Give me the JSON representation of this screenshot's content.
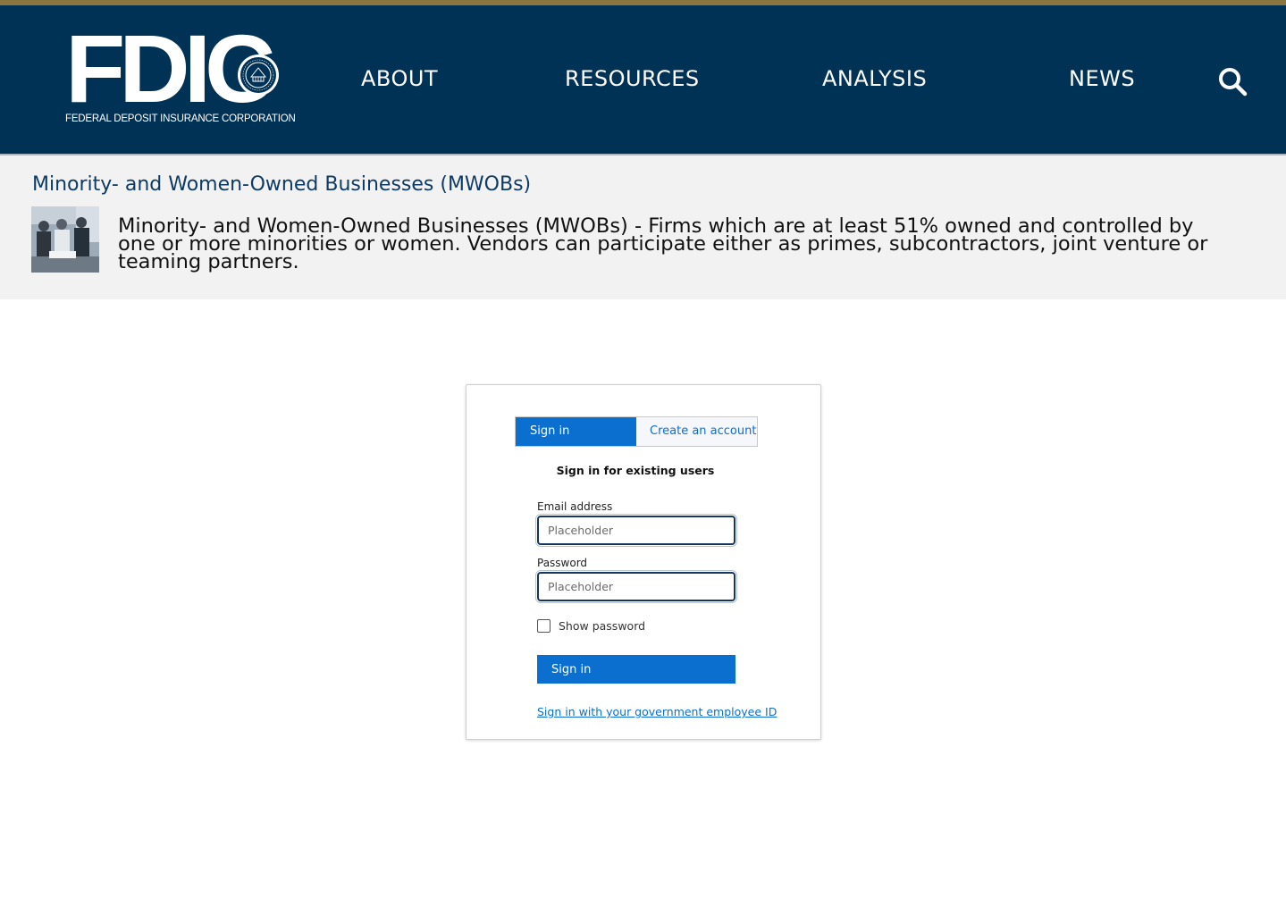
{
  "header": {
    "logo_text": "FDIC",
    "logo_subtitle": "FEDERAL DEPOSIT INSURANCE CORPORATION",
    "seal_icon": "fdic-seal-icon",
    "nav": [
      {
        "label": "ABOUT"
      },
      {
        "label": "RESOURCES"
      },
      {
        "label": "ANALYSIS"
      },
      {
        "label": "NEWS"
      }
    ],
    "search_icon": "search-icon"
  },
  "banner": {
    "title": "Minority- and Women-Owned Businesses (MWOBs)",
    "description": "Minority- and Women-Owned Businesses (MWOBs) - Firms which are at least 51% owned and controlled by one or more minorities or women. Vendors can participate either as primes, subcontractors, joint venture or teaming partners."
  },
  "login": {
    "tabs": [
      {
        "label": "Sign in",
        "active": true
      },
      {
        "label": "Create an account",
        "active": false
      }
    ],
    "heading": "Sign in for existing users",
    "email": {
      "label": "Email address",
      "placeholder": "Placeholder",
      "value": ""
    },
    "password": {
      "label": "Password",
      "placeholder": "Placeholder",
      "value": ""
    },
    "show_password_label": "Show password",
    "show_password_checked": false,
    "submit_label": "Sign in",
    "gov_link": "Sign in with your government employee ID"
  },
  "colors": {
    "header_bg": "#003256",
    "gold_accent": "#8a7440",
    "primary_blue": "#0b6fcf",
    "banner_bg": "#f2f2f2",
    "title_blue": "#0d3b66"
  }
}
